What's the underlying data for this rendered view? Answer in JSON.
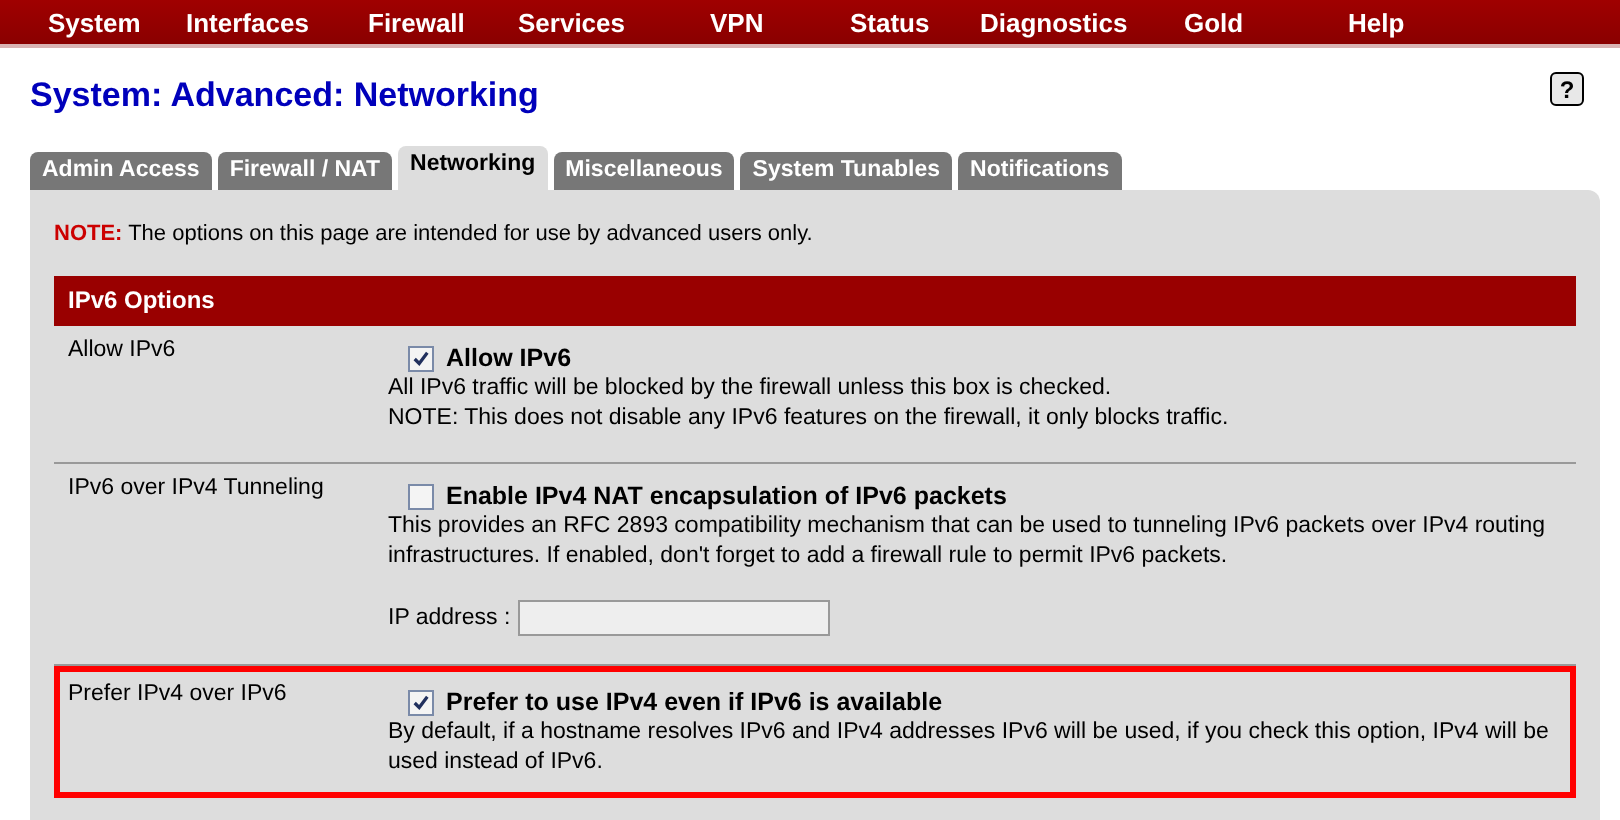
{
  "menu": [
    {
      "label": "System"
    },
    {
      "label": "Interfaces"
    },
    {
      "label": "Firewall"
    },
    {
      "label": "Services"
    },
    {
      "label": "VPN"
    },
    {
      "label": "Status"
    },
    {
      "label": "Diagnostics"
    },
    {
      "label": "Gold"
    },
    {
      "label": "Help"
    }
  ],
  "page_title": "System: Advanced: Networking",
  "help_icon": "?",
  "tabs": [
    {
      "label": "Admin Access",
      "selected": false
    },
    {
      "label": "Firewall / NAT",
      "selected": false
    },
    {
      "label": "Networking",
      "selected": true
    },
    {
      "label": "Miscellaneous",
      "selected": false
    },
    {
      "label": "System Tunables",
      "selected": false
    },
    {
      "label": "Notifications",
      "selected": false
    }
  ],
  "note": {
    "label": "NOTE:",
    "text": "The options on this page are intended for use by advanced users only."
  },
  "section": "IPv6 Options",
  "rows": [
    {
      "label": "Allow IPv6",
      "highlighted": false,
      "checkbox": {
        "label": "Allow IPv6",
        "checked": true
      },
      "description": [
        "All IPv6 traffic will be blocked by the firewall unless this box is checked.",
        "NOTE: This does not disable any IPv6 features on the firewall, it only blocks traffic."
      ]
    },
    {
      "label": "IPv6 over IPv4 Tunneling",
      "highlighted": false,
      "checkbox": {
        "label": "Enable IPv4 NAT encapsulation of IPv6 packets",
        "checked": false
      },
      "description": [
        "This provides an RFC 2893 compatibility mechanism that can be used to tunneling IPv6 packets over IPv4 routing infrastructures. If enabled, don't forget to add a firewall rule to permit IPv6 packets."
      ],
      "field": {
        "label": "IP address :"
      }
    },
    {
      "label": "Prefer IPv4 over IPv6",
      "highlighted": true,
      "checkbox": {
        "label": "Prefer to use IPv4 even if IPv6 is available",
        "checked": true
      },
      "description": [
        "By default, if a hostname resolves IPv6 and IPv4 addresses IPv6 will be used, if you check this option, IPv4 will be used instead of IPv6."
      ]
    }
  ]
}
